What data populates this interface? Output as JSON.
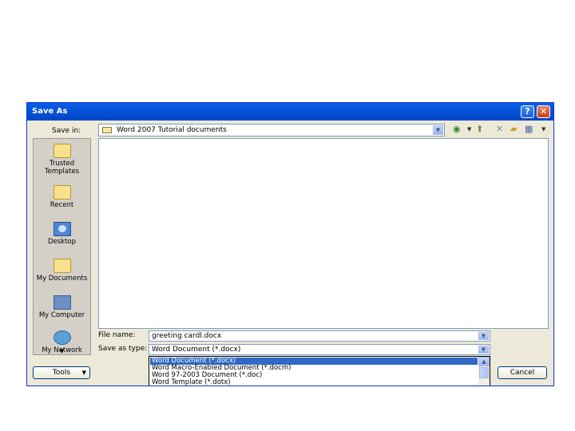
{
  "dialog": {
    "title": "Save As",
    "help_glyph": "?",
    "close_glyph": "✕"
  },
  "save_in": {
    "label": "Save in:",
    "value": "Word 2007 Tutorial documents"
  },
  "places": [
    {
      "label": "Trusted Templates",
      "icon": "folder-icon"
    },
    {
      "label": "Recent",
      "icon": "folder-icon"
    },
    {
      "label": "Desktop",
      "icon": "desktop-icon"
    },
    {
      "label": "My Documents",
      "icon": "my-documents-icon"
    },
    {
      "label": "My Computer",
      "icon": "my-computer-icon"
    },
    {
      "label": "My Network",
      "icon": "network-icon"
    }
  ],
  "file_name": {
    "label": "File name:",
    "value": "greeting cardl.docx"
  },
  "save_as_type": {
    "label": "Save as type:",
    "value": "Word Document (*.docx)",
    "options": [
      "Word Document (*.docx)",
      "Word Macro-Enabled Document (*.docm)",
      "Word 97-2003 Document (*.doc)",
      "Word Template (*.dotx)"
    ]
  },
  "buttons": {
    "tools": "Tools",
    "cancel": "Cancel"
  },
  "colors": {
    "titlebar": "#0453d8",
    "selection": "#316ac5",
    "dialog_bg": "#ece9d8"
  }
}
